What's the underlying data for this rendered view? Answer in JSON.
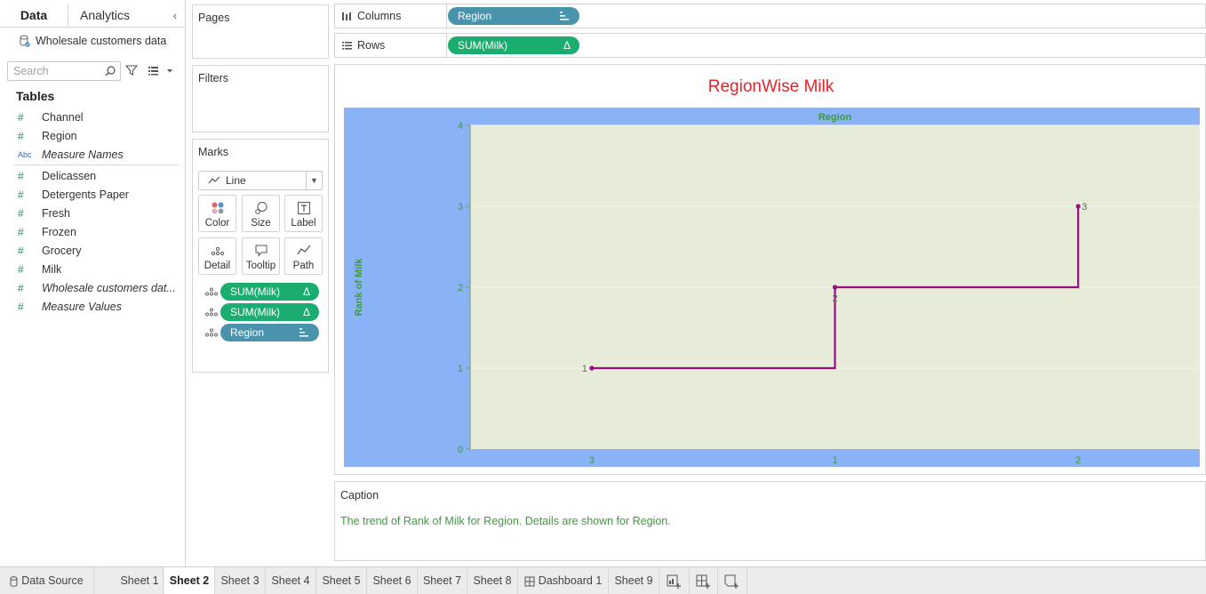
{
  "left_pane": {
    "tab_data": "Data",
    "tab_analytics": "Analytics",
    "datasource": "Wholesale customers data",
    "search_placeholder": "Search",
    "tables_title": "Tables",
    "dimensions": [
      {
        "type": "#",
        "name": "Channel",
        "italic": false
      },
      {
        "type": "#",
        "name": "Region",
        "italic": false
      },
      {
        "type": "Abc",
        "name": "Measure Names",
        "italic": true
      }
    ],
    "measures": [
      {
        "type": "#",
        "name": "Delicassen",
        "italic": false
      },
      {
        "type": "#",
        "name": "Detergents Paper",
        "italic": false
      },
      {
        "type": "#",
        "name": "Fresh",
        "italic": false
      },
      {
        "type": "#",
        "name": "Frozen",
        "italic": false
      },
      {
        "type": "#",
        "name": "Grocery",
        "italic": false
      },
      {
        "type": "#",
        "name": "Milk",
        "italic": false
      },
      {
        "type": "#",
        "name": "Wholesale customers dat...",
        "italic": true
      },
      {
        "type": "#",
        "name": "Measure Values",
        "italic": true
      }
    ]
  },
  "pages": {
    "title": "Pages"
  },
  "filters": {
    "title": "Filters"
  },
  "marks": {
    "title": "Marks",
    "type": "Line",
    "buttons": {
      "color": "Color",
      "size": "Size",
      "label": "Label",
      "detail": "Detail",
      "tooltip": "Tooltip",
      "path": "Path"
    },
    "pills": [
      {
        "label": "SUM(Milk)",
        "icon": "Δ",
        "color": "green"
      },
      {
        "label": "SUM(Milk)",
        "icon": "Δ",
        "color": "green"
      },
      {
        "label": "Region",
        "icon": "sort-icon",
        "color": "blue"
      }
    ]
  },
  "shelves": {
    "columns_label": "Columns",
    "columns_pill": "Region",
    "rows_label": "Rows",
    "rows_pill": "SUM(Milk)",
    "rows_pill_icon": "Δ"
  },
  "view": {
    "title": "RegionWise Milk"
  },
  "chart_data": {
    "type": "line",
    "title": "RegionWise Milk",
    "xlabel": "Region",
    "ylabel": "Rank of Milk",
    "categories": [
      "3",
      "1",
      "2"
    ],
    "values": [
      1,
      2,
      3
    ],
    "point_labels": [
      "1",
      "2",
      "3"
    ],
    "step": true,
    "ylim": [
      0,
      4
    ],
    "yticks": [
      0,
      1,
      2,
      3,
      4
    ],
    "grid": true,
    "colors": {
      "line": "#990f7f",
      "header_band": "#8ab3f7",
      "plot_bg": "#e6ecd8",
      "axis_text": "#3f9a3f"
    }
  },
  "caption": {
    "title": "Caption",
    "text": "The trend of Rank of Milk for Region.  Details are shown for Region."
  },
  "tabs": [
    {
      "label": "Data Source",
      "icon": "datasource-icon"
    },
    {
      "label": "Sheet 1"
    },
    {
      "label": "Sheet 2",
      "active": true
    },
    {
      "label": "Sheet 3"
    },
    {
      "label": "Sheet 4"
    },
    {
      "label": "Sheet 5"
    },
    {
      "label": "Sheet 6"
    },
    {
      "label": "Sheet 7"
    },
    {
      "label": "Sheet 8"
    },
    {
      "label": "Dashboard 1",
      "icon": "dashboard-icon"
    },
    {
      "label": "Sheet 9"
    }
  ]
}
